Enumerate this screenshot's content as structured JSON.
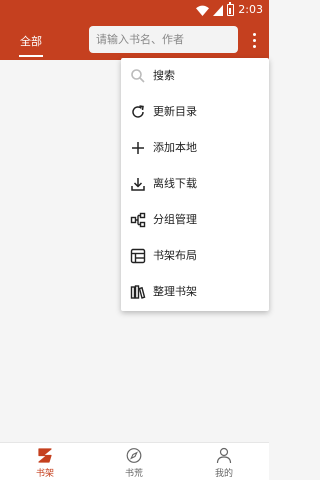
{
  "status_bar": {
    "time": "2:03"
  },
  "header": {
    "tab_label": "全部",
    "search_placeholder": "请输入书名、作者"
  },
  "menu": {
    "items": [
      {
        "label": "搜索",
        "icon": "search-icon"
      },
      {
        "label": "更新目录",
        "icon": "refresh-icon"
      },
      {
        "label": "添加本地",
        "icon": "plus-icon"
      },
      {
        "label": "离线下载",
        "icon": "download-icon"
      },
      {
        "label": "分组管理",
        "icon": "group-icon"
      },
      {
        "label": "书架布局",
        "icon": "layout-icon"
      },
      {
        "label": "整理书架",
        "icon": "bookshelf-icon"
      }
    ]
  },
  "bottom_nav": {
    "items": [
      {
        "label": "书架",
        "icon": "bookshelf-nav-icon",
        "active": true
      },
      {
        "label": "书荒",
        "icon": "compass-icon",
        "active": false
      },
      {
        "label": "我的",
        "icon": "user-icon",
        "active": false
      }
    ]
  },
  "colors": {
    "primary": "#c5401f",
    "background": "#f5f5f5",
    "menu_bg": "#ffffff"
  }
}
